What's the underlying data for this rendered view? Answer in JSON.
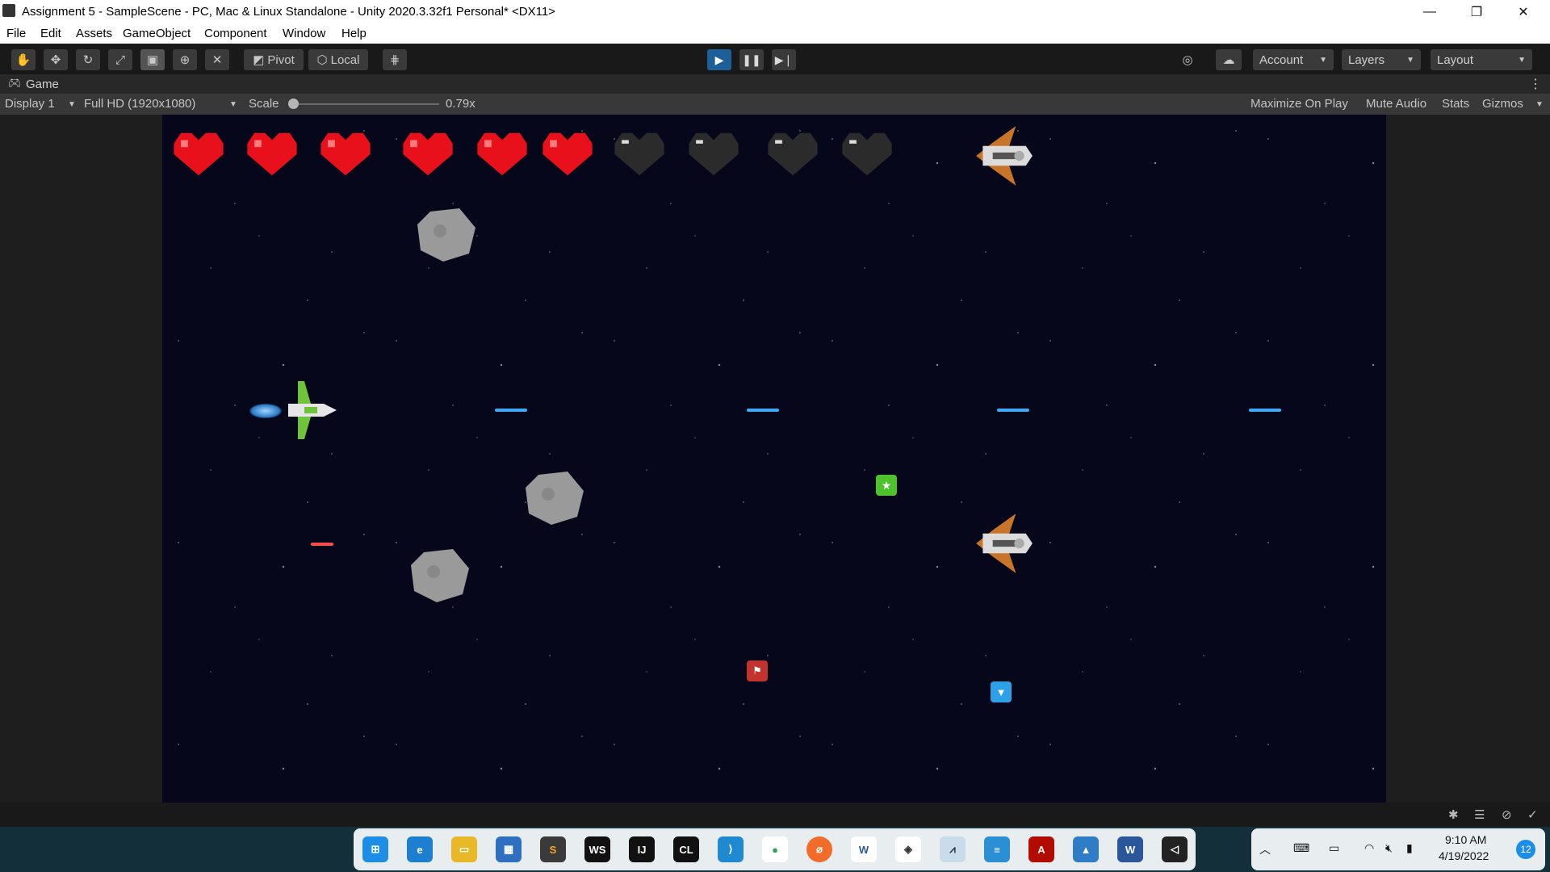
{
  "window": {
    "title": "Assignment 5 - SampleScene - PC, Mac & Linux Standalone - Unity 2020.3.32f1 Personal* <DX11>",
    "minimize": "—",
    "maximize": "❐",
    "close": "✕"
  },
  "menu": [
    "File",
    "Edit",
    "Assets",
    "GameObject",
    "Component",
    "Window",
    "Help"
  ],
  "toolbar": {
    "pivot": "Pivot",
    "local": "Local",
    "account": "Account",
    "layers": "Layers",
    "layout": "Layout"
  },
  "game_tab": {
    "label": "Game",
    "display": "Display 1",
    "resolution": "Full HD (1920x1080)",
    "scale_label": "Scale",
    "scale_value": "0.79x",
    "maximize": "Maximize On Play",
    "mute": "Mute Audio",
    "stats": "Stats",
    "gizmos": "Gizmos"
  },
  "game": {
    "hearts_full": 6,
    "hearts_total": 10
  },
  "tray": {
    "time": "9:10 AM",
    "date": "4/19/2022",
    "notifications": "12"
  },
  "taskbar_icons": [
    "start-icon",
    "edge-icon",
    "file-explorer-icon",
    "store-icon",
    "sublime-icon",
    "webstorm-icon",
    "intellij-icon",
    "clion-icon",
    "vscode-icon",
    "sourcetree-icon",
    "postman-icon",
    "word-online-icon",
    "unity-hub-icon",
    "stocks-icon",
    "notepad-icon",
    "acrobat-icon",
    "photos-icon",
    "word-icon",
    "unity-icon"
  ]
}
